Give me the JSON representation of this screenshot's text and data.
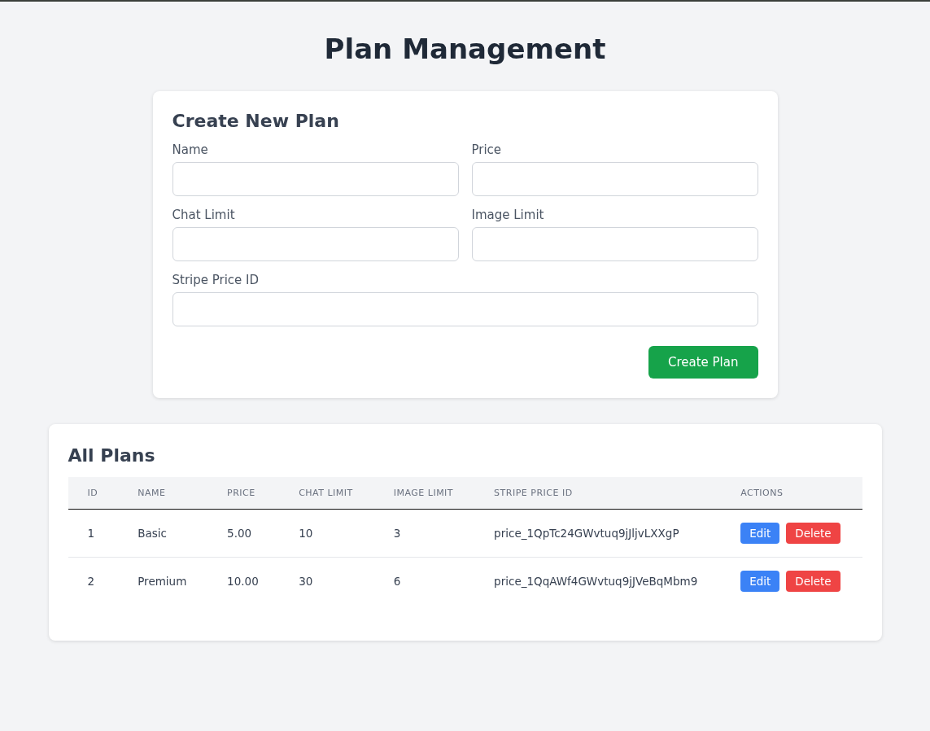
{
  "title": "Plan Management",
  "form": {
    "heading": "Create New Plan",
    "fields": [
      {
        "label": "Name",
        "wide": false
      },
      {
        "label": "Price",
        "wide": false
      },
      {
        "label": "Chat Limit",
        "wide": false
      },
      {
        "label": "Image Limit",
        "wide": false
      },
      {
        "label": "Stripe Price ID",
        "wide": true
      }
    ],
    "submit": "Create Plan"
  },
  "table": {
    "heading": "All Plans",
    "columns": [
      "ID",
      "NAME",
      "PRICE",
      "CHAT LIMIT",
      "IMAGE LIMIT",
      "STRIPE PRICE ID",
      "ACTIONS"
    ],
    "rows": [
      {
        "cells": [
          "1",
          "Basic",
          "5.00",
          "10",
          "3",
          "price_1QpTc24GWvtuq9jJljvLXXgP"
        ],
        "actions": [
          {
            "kind": "edit",
            "label": "Edit"
          },
          {
            "kind": "delete",
            "label": "Delete"
          }
        ]
      },
      {
        "cells": [
          "2",
          "Premium",
          "10.00",
          "30",
          "6",
          "price_1QqAWf4GWvtuq9jJVeBqMbm9"
        ],
        "actions": [
          {
            "kind": "edit",
            "label": "Edit"
          },
          {
            "kind": "delete",
            "label": "Delete"
          }
        ]
      }
    ]
  }
}
